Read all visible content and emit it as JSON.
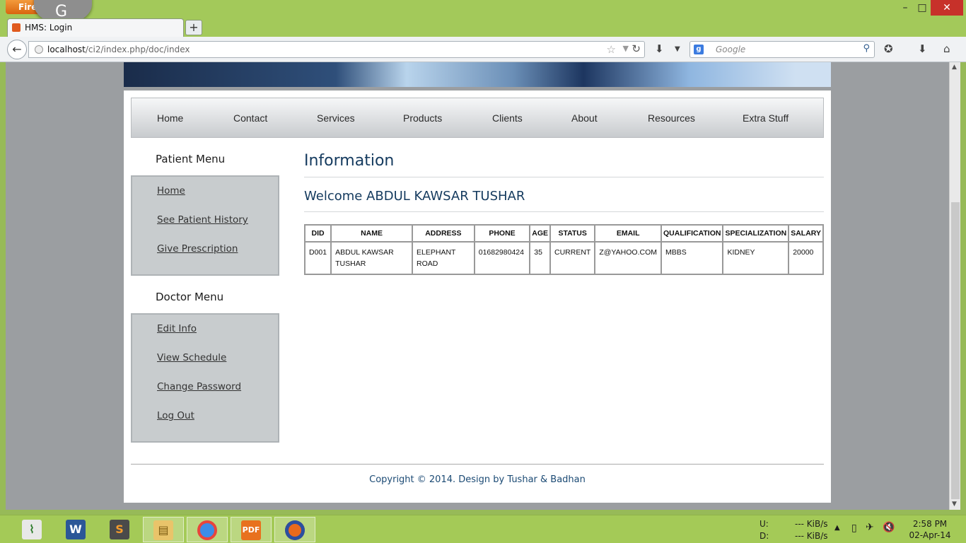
{
  "browser": {
    "app_button": "Firefox",
    "tab_title": "HMS: Login",
    "new_tab": "+",
    "url_host": "localhost",
    "url_path": "/ci2/index.php/doc/index",
    "search_placeholder": "Google",
    "window_controls": {
      "minimize": "–",
      "maximize": "□",
      "close": "✕"
    }
  },
  "site": {
    "nav": [
      "Home",
      "Contact",
      "Services",
      "Products",
      "Clients",
      "About",
      "Resources",
      "Extra Stuff"
    ],
    "patient_menu": {
      "title": "Patient Menu",
      "items": [
        "Home",
        "See Patient History",
        "Give Prescription"
      ]
    },
    "doctor_menu": {
      "title": "Doctor Menu",
      "items": [
        "Edit Info",
        "View Schedule",
        "Change Password",
        "Log Out"
      ]
    },
    "heading": "Information",
    "welcome": "Welcome ABDUL KAWSAR TUSHAR",
    "table": {
      "headers": [
        "DID",
        "NAME",
        "ADDRESS",
        "PHONE",
        "AGE",
        "STATUS",
        "EMAIL",
        "QUALIFICATION",
        "SPECIALIZATION",
        "SALARY"
      ],
      "rows": [
        [
          "D001",
          "ABDUL KAWSAR TUSHAR",
          "ELEPHANT ROAD",
          "01682980424",
          "35",
          "CURRENT",
          "Z@YAHOO.COM",
          "MBBS",
          "KIDNEY",
          "20000"
        ]
      ]
    },
    "footer": "Copyright © 2014. Design by Tushar & Badhan"
  },
  "taskbar": {
    "apps": [
      "task-manager",
      "word",
      "sublime",
      "file-explorer",
      "chrome",
      "pdf",
      "firefox"
    ],
    "net_up_label": "U:",
    "net_down_label": "D:",
    "net_up_value": "--- KiB/s",
    "net_down_value": "--- KiB/s",
    "time": "2:58 PM",
    "date": "02-Apr-14"
  }
}
